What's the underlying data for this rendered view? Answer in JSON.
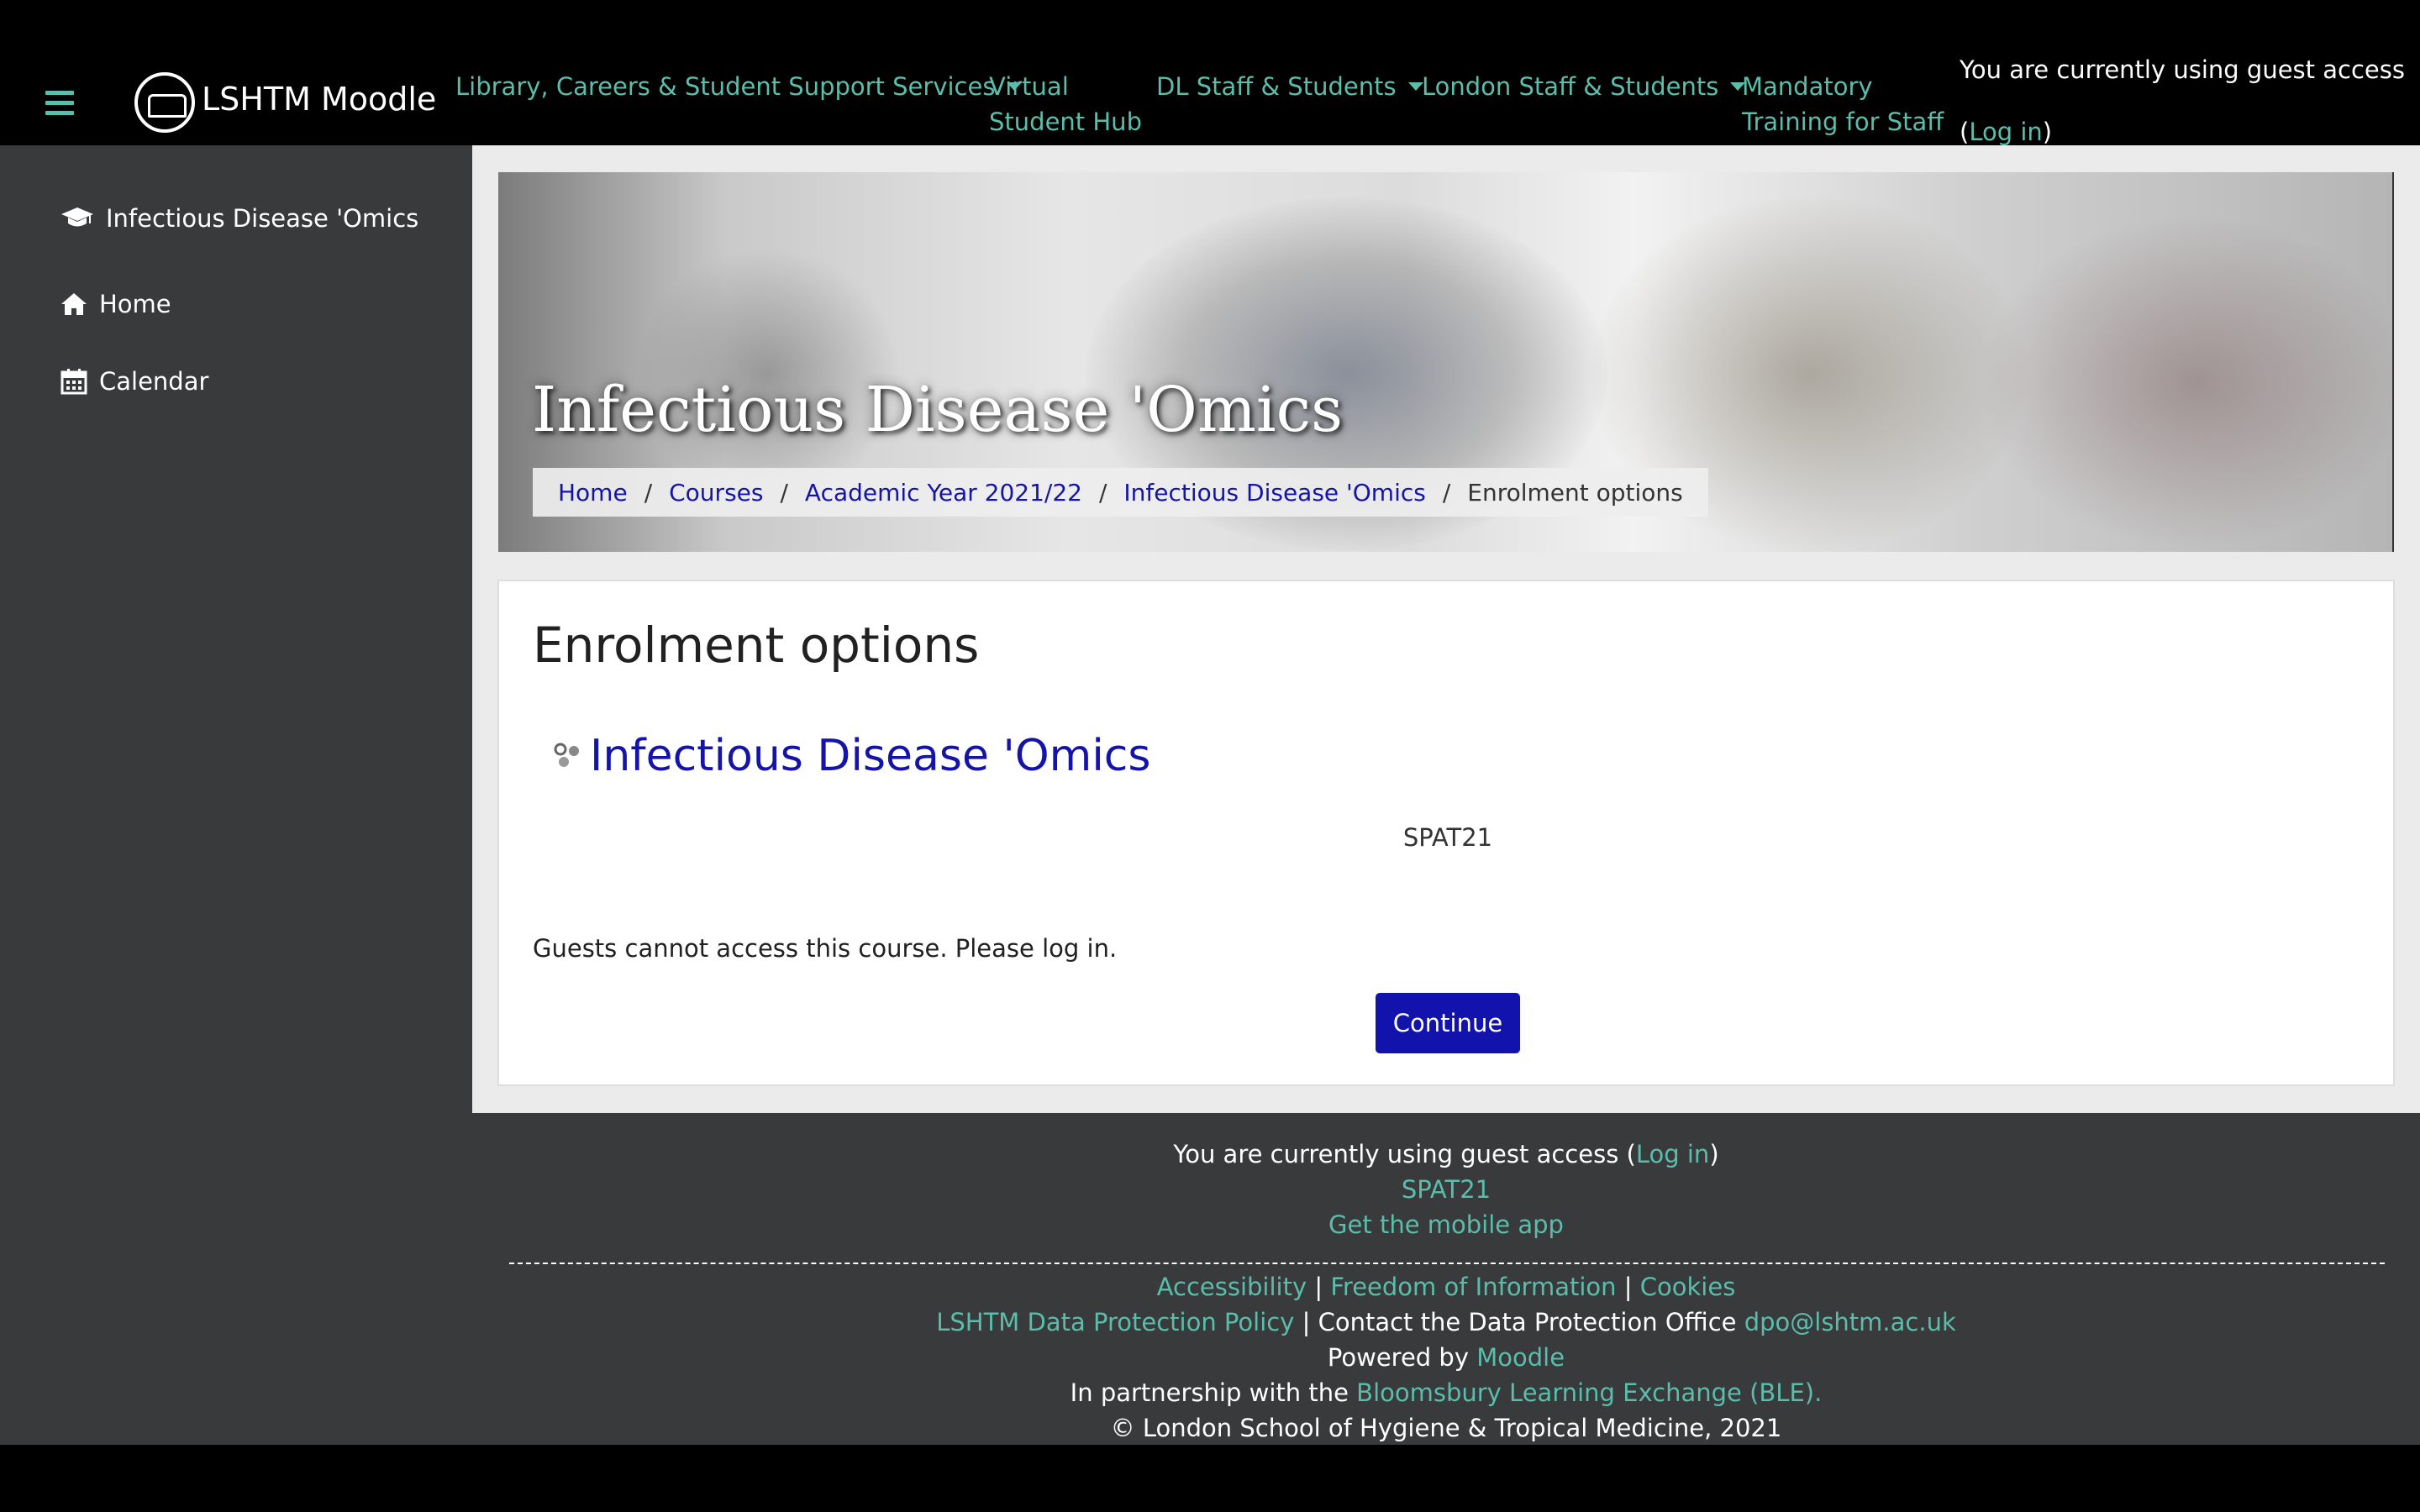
{
  "navbar": {
    "brand": "LSHTM Moodle",
    "menu": [
      {
        "label": "Library, Careers & Student Support Services",
        "dropdown": true
      },
      {
        "label_line1": "Virtual",
        "label_line2": "Student Hub"
      },
      {
        "label": "DL Staff & Students",
        "dropdown": true
      },
      {
        "label": "London Staff & Students",
        "dropdown": true
      },
      {
        "label_line1": "Mandatory",
        "label_line2": "Training for Staff"
      }
    ],
    "guest_text": "You are currently using guest access",
    "login_open": "(",
    "login_label": "Log in",
    "login_close": ")"
  },
  "sidebar": {
    "items": [
      {
        "label": "Infectious Disease 'Omics",
        "icon": "graduation-cap-icon"
      },
      {
        "label": "Home",
        "icon": "home-icon"
      },
      {
        "label": "Calendar",
        "icon": "calendar-icon"
      }
    ]
  },
  "header": {
    "course_title": "Infectious Disease 'Omics",
    "breadcrumb": [
      "Home",
      "Courses",
      "Academic Year 2021/22",
      "Infectious Disease 'Omics",
      "Enrolment options"
    ],
    "separator": "/"
  },
  "main": {
    "page_title": "Enrolment options",
    "course_link": "Infectious Disease 'Omics",
    "course_code": "SPAT21",
    "guest_message": "Guests cannot access this course. Please log in.",
    "continue_label": "Continue"
  },
  "footer": {
    "guest_prefix": "You are currently using guest access (",
    "login_label": "Log in",
    "guest_suffix": ")",
    "course_code": "SPAT21",
    "mobile_app": "Get the mobile app",
    "accessibility": "Accessibility",
    "foi": "Freedom of Information",
    "cookies": "Cookies",
    "pipe": "|",
    "data_policy": "LSHTM Data Protection Policy",
    "contact_dpo": "Contact the Data Protection Office",
    "dpo_email": "dpo@lshtm.ac.uk",
    "powered_by": "Powered by",
    "moodle": "Moodle",
    "partnership": "In partnership with the",
    "ble": "Bloomsbury Learning Exchange (BLE).",
    "copyright": "© London School of Hygiene & Tropical Medicine, 2021"
  },
  "colors": {
    "accent_teal": "#5bbdab",
    "link_blue": "#1414a8",
    "button_blue": "#1212ad",
    "sidebar_bg": "#393a3c"
  }
}
